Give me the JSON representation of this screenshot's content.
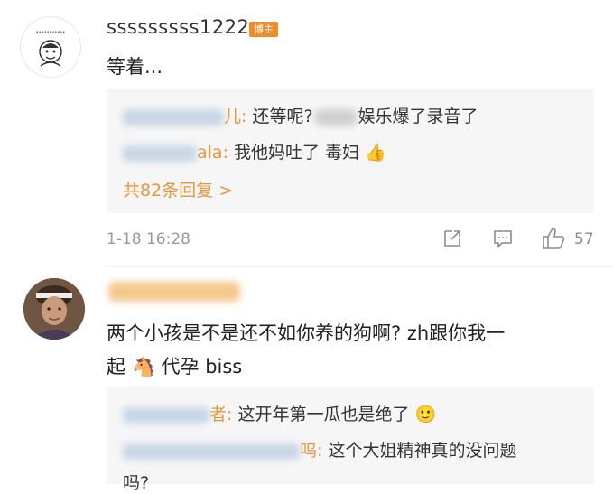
{
  "comment1": {
    "username": "sssssssss1222",
    "badge": "博主",
    "text": "等着...",
    "replies": [
      {
        "name_suffix": "儿:",
        "text_a": "还等呢?",
        "text_b": "娱乐爆了录音了"
      },
      {
        "name_suffix": "ala:",
        "text": "我他妈吐了 毒妇",
        "emoji": "👍"
      }
    ],
    "more_replies": "共82条回复 >",
    "time": "1-18 16:28",
    "likes": "57"
  },
  "comment2": {
    "text_line1": "两个小孩是不是还不如你养的狗啊? zh跟你我一",
    "text_line2_a": "起",
    "emoji_horse": "🐴",
    "text_line2_b": "代孕 biss",
    "replies": [
      {
        "name_suffix": "者:",
        "text": "这开年第一瓜也是绝了",
        "emoji": "🙂"
      },
      {
        "name_suffix": "呜:",
        "text": "这个大姐精神真的没问题",
        "continuation": "吗?"
      }
    ]
  },
  "icons": [
    "share-icon",
    "comment-icon",
    "thumbs-up-icon"
  ],
  "colors": {
    "accent": "#e8963b",
    "badge": "#f08d2b",
    "reply_bg": "#f6f6f6",
    "meta": "#9a9a9a"
  }
}
